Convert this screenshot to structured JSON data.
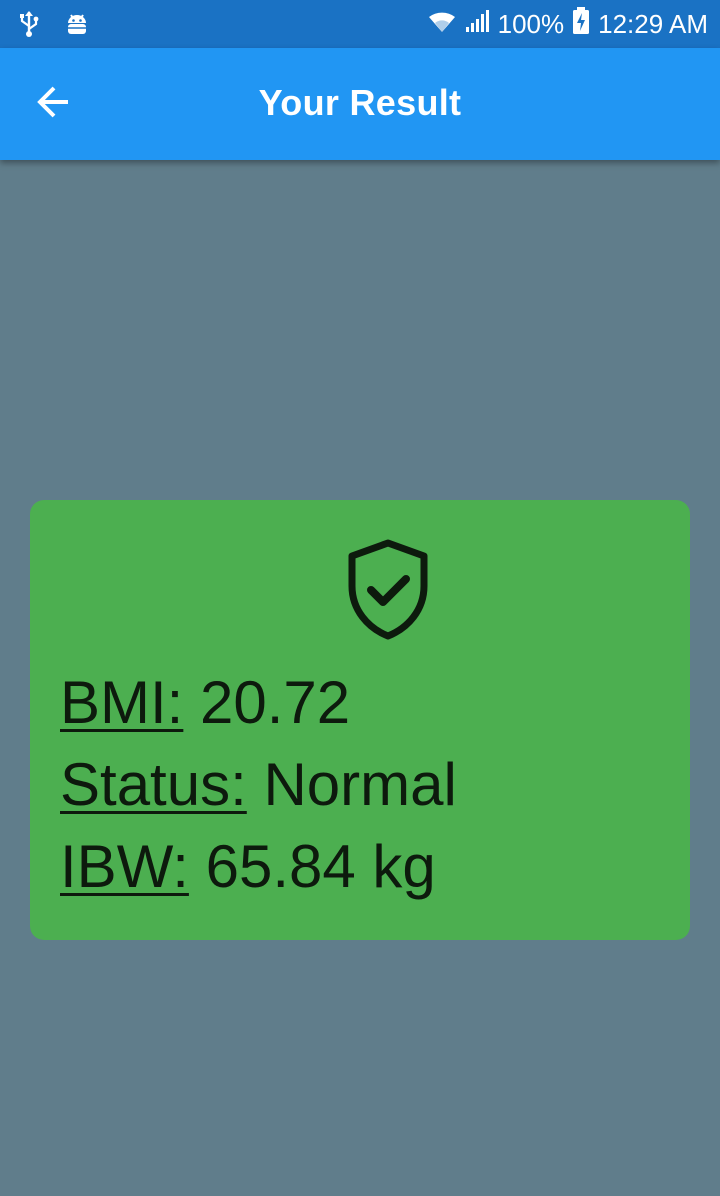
{
  "status_bar": {
    "icons_left": [
      "usb-icon",
      "android-debug-icon"
    ],
    "icons_right": [
      "wifi-icon",
      "signal-icon",
      "battery-charging-icon"
    ],
    "battery": "100%",
    "time": "12:29 AM"
  },
  "app_bar": {
    "back_icon": "arrow-back-icon",
    "title": "Your Result"
  },
  "result": {
    "icon": "shield-check-icon",
    "bmi_label": "BMI:",
    "bmi_value": "20.72",
    "status_label": "Status:",
    "status_value": "Normal",
    "ibw_label": "IBW:",
    "ibw_value": "65.84 kg"
  },
  "colors": {
    "status_bar": "#1a72c4",
    "app_bar": "#2196f3",
    "background": "#607d8b",
    "card": "#4caf50",
    "text": "#0d1a0d"
  }
}
